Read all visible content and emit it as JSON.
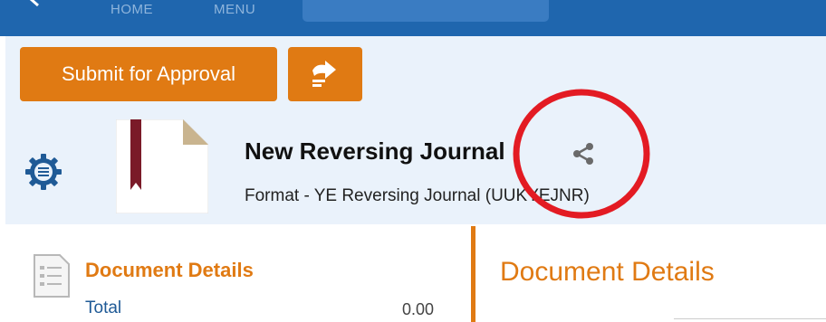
{
  "top_nav": {
    "home_label": "HOME",
    "menu_label": "MENU",
    "background_color": "#1f66ae"
  },
  "toolbar": {
    "submit_label": "Submit for Approval",
    "action_icon": "forward-arrow-icon",
    "accent_color": "#e07a13"
  },
  "header": {
    "settings_icon": "gear-icon",
    "document_icon": "bookmarked-document-icon",
    "title": "New Reversing Journal",
    "share_icon": "share-icon",
    "subtitle": "Format - YE Reversing Journal (UUKYEJNR)",
    "annotation_color": "#e31b23"
  },
  "left_panel": {
    "icon": "document-details-icon",
    "heading": "Document Details",
    "total_label": "Total",
    "total_value": "0.00"
  },
  "right_panel": {
    "heading": "Document Details"
  }
}
